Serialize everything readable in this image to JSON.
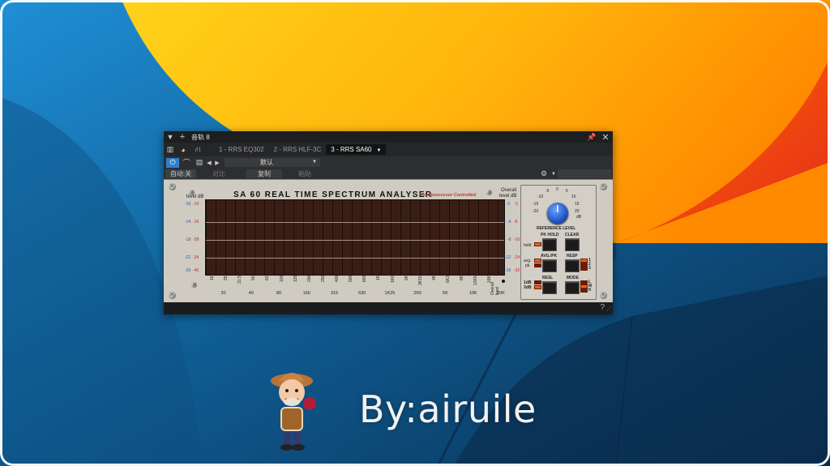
{
  "window": {
    "title": "音轨 8",
    "tabs": [
      {
        "label": "1 - RRS EQ302"
      },
      {
        "label": "2 - RRS HLF-3C"
      },
      {
        "label": "3 - RRS SA60"
      }
    ],
    "preset": "默认",
    "auto_label": "自动:关",
    "compare_label": "对比",
    "copy_label": "复制",
    "paste_label": "粘贴",
    "help_label": "?"
  },
  "plugin": {
    "title": "SA 60  REAL TIME  SPECTRUM  ANALYSER",
    "subtitle": "Microprocessor Controlled",
    "level_db_left": "level dB",
    "overall_label": "Overall",
    "level_db_right": "level dB",
    "left_scale_blue": [
      "-16",
      "-14",
      "-18",
      "-22",
      "-25"
    ],
    "left_scale_red": [
      "-10",
      "-16",
      "-28",
      "-34",
      "-40"
    ],
    "right_scale_blue": [
      "0",
      "-4",
      "-8",
      "-12",
      "-16"
    ],
    "right_scale_red": [
      "0",
      "-8",
      "-16",
      "-24",
      "-32"
    ],
    "freq_top": [
      "16",
      "25",
      "31.5",
      "50",
      "63",
      "100",
      "125",
      "200",
      "250",
      "400",
      "500",
      "800",
      "1K",
      "1K6",
      "2K",
      "3K15",
      "4K",
      "6K3",
      "8K",
      "12K5",
      "16K"
    ],
    "freq_bottom": [
      "20",
      "40",
      "80",
      "160",
      "315",
      "630",
      "1K25",
      "2K5",
      "5K",
      "10K",
      "20K"
    ],
    "overall_level_label": "Overall level",
    "ref_scale": [
      "-5",
      "0",
      "5",
      "-10",
      "10",
      "-15",
      "15",
      "-20",
      "20"
    ],
    "ref_unit": "dB",
    "reference_level_label": "REFERENCE LEVEL",
    "pk_hold_label": "PK HOLD",
    "clear_label": "CLEAR",
    "avg_pk_label": "AVG./PK",
    "resp_label": "RESP",
    "resl_label": "RESL",
    "mode_label": "MODE",
    "held_label": "held",
    "avg_label": "avg.",
    "pk_label": "pk.",
    "db1_label": "1dB",
    "db3_label": "3dB",
    "resp_leds": [
      "1",
      "2",
      "3"
    ],
    "mode_leds": [
      "L",
      "M",
      "K"
    ]
  },
  "watermark": {
    "text": "By:airuile"
  },
  "colors": {
    "panel": "#cfcbc1",
    "display": "#3a1e15",
    "knob": "#2a5fd8",
    "led": "#ff5a1a"
  }
}
